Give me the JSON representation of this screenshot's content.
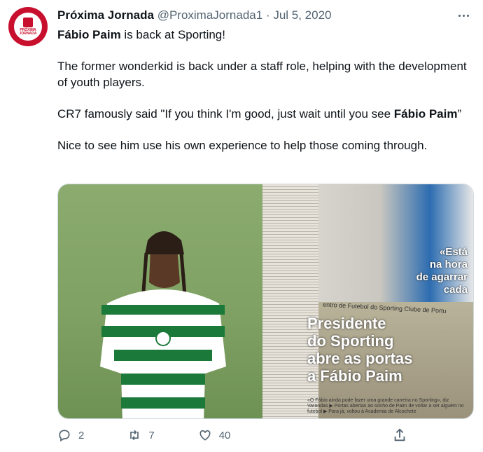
{
  "tweet": {
    "author_name": "Próxima Jornada",
    "handle": "@ProximaJornada1",
    "separator": "·",
    "date": "Jul 5, 2020",
    "avatar_text": "PRÓXIMA JORNADA",
    "line1_bold": "Fábio Paim",
    "line1_rest": " is back at Sporting!",
    "para2": "The former wonderkid is back under a staff role, helping with the development of youth players.",
    "para3_start": "CR7  famously said \"If you think I'm good, just wait until you see ",
    "para3_bold": "Fábio Paim",
    "para3_end": "”",
    "para4": "Nice to see him use his own experience to help those coming through."
  },
  "media": {
    "quote_lines": [
      "«Está",
      "na hora",
      "de agarrar",
      "cada"
    ],
    "headline_lines": [
      "Presidente",
      "do Sporting",
      "abre as portas",
      "a Fábio Paim"
    ],
    "sign_text": "entro de Futebol do Sporting Clube de Portu",
    "caption": "«O Fábio ainda pode fazer uma grande carreira no Sporting», diz Varandas ▶ Portas abertas ao sonho de Paim de voltar a ser alguém no futebol ▶ Para já, voltou à Academia de Alcochete"
  },
  "actions": {
    "reply_count": "2",
    "retweet_count": "7",
    "like_count": "40"
  },
  "colors": {
    "sporting_green": "#1b7a3a",
    "brand_red": "#c8102e",
    "text_secondary": "#536471"
  }
}
